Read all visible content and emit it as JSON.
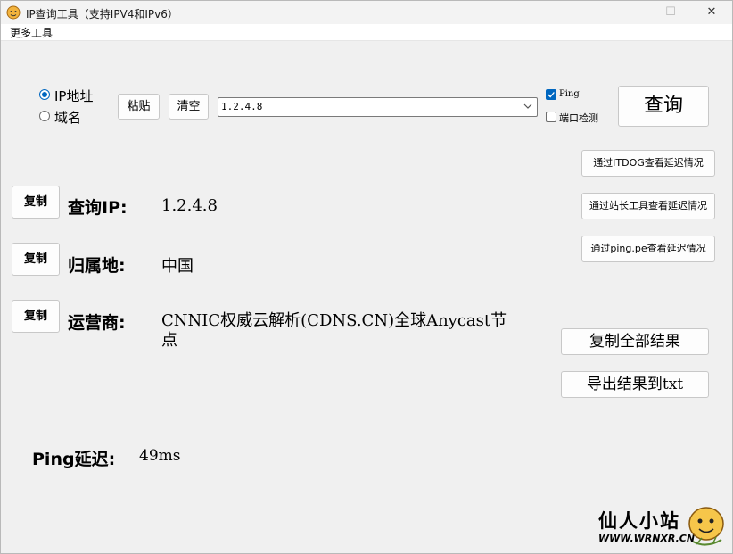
{
  "window": {
    "title": "IP查询工具（支持IPV4和IPv6）",
    "controls": {
      "minimize": "—",
      "maximize": "☐",
      "close": "✕"
    }
  },
  "menu": {
    "more_tools": "更多工具"
  },
  "query": {
    "mode_ip_label": "IP地址",
    "mode_domain_label": "域名",
    "mode_selected": "IP地址",
    "paste_button": "粘贴",
    "clear_button": "清空",
    "input_value": "1.2.4.8",
    "ping_label": "Ping",
    "ping_checked": true,
    "port_check_label": "端口检测",
    "port_check_checked": false,
    "query_button": "查询"
  },
  "results": {
    "ip_label": "查询IP:",
    "ip_value": "1.2.4.8",
    "location_label": "归属地:",
    "location_value": "中国",
    "isp_label": "运营商:",
    "isp_value": "CNNIC权威云解析(CDNS.CN)全球Anycast节点",
    "copy_label": "复制",
    "ping_label": "Ping延迟:",
    "ping_value": "49ms"
  },
  "actions": {
    "itdog": "通过ITDOG查看延迟情况",
    "chinaz": "通过站长工具查看延迟情况",
    "pingpe": "通过ping.pe查看延迟情况",
    "copy_all": "复制全部结果",
    "export_txt": "导出结果到txt"
  },
  "watermark": {
    "name": "仙人小站",
    "url": "WWW.WRNXR.CN"
  },
  "colors": {
    "accent": "#0067c0",
    "title_bg": "#f3f3f3",
    "client_bg": "#f0f0f0"
  }
}
